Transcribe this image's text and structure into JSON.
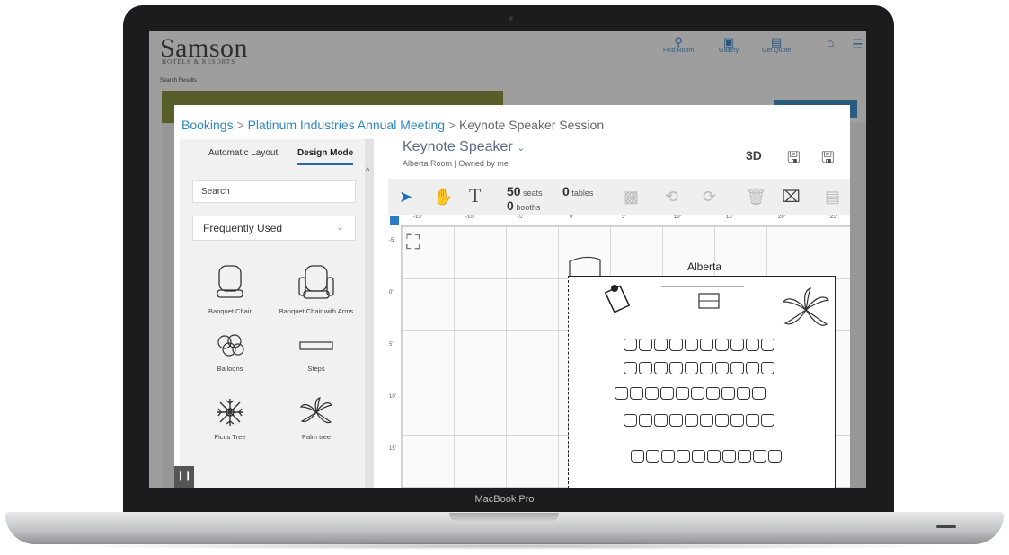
{
  "device": {
    "label": "MacBook Pro"
  },
  "site": {
    "logo": "Samson",
    "logo_sub": "HOTELS & RESORTS",
    "nav": [
      {
        "label": "Find Room",
        "icon": "search-icon"
      },
      {
        "label": "Gallery",
        "icon": "camera-icon"
      },
      {
        "label": "Get Quote",
        "icon": "document-icon"
      }
    ],
    "search_results": "Search Results"
  },
  "breadcrumb": {
    "items": [
      "Bookings",
      "Platinum Industries Annual Meeting"
    ],
    "current": "Keynote Speaker Session",
    "separator": ">"
  },
  "sidebar": {
    "tabs": [
      "Automatic Layout",
      "Design Mode"
    ],
    "active_tab": "Design Mode",
    "search_value": "Search",
    "dropdown_value": "Frequently Used",
    "items": [
      {
        "label": "Banquet Chair"
      },
      {
        "label": "Banquet Chair with Arms"
      },
      {
        "label": "Balloons"
      },
      {
        "label": "Steps"
      },
      {
        "label": "Ficus Tree"
      },
      {
        "label": "Palm tree"
      }
    ]
  },
  "design": {
    "title": "Keynote Speaker",
    "subtitle_room": "Alberta Room",
    "subtitle_owner": "Owned by me",
    "seats_count": "50",
    "seats_label": "seats",
    "tables_count": "0",
    "tables_label": "tables",
    "booths_count": "0",
    "booths_label": "booths",
    "room_label": "Alberta",
    "ruler_top": [
      "-15'",
      "-10'",
      "-5'",
      "0'",
      "5'",
      "10'",
      "15'",
      "20'",
      "25'"
    ],
    "ruler_left": [
      "-5'",
      "0'",
      "5'",
      "10'",
      "15'"
    ],
    "header_icons": [
      "3d-view-icon",
      "save-icon",
      "save-as-icon"
    ],
    "tools": [
      "select-icon",
      "pan-icon",
      "text-icon",
      "group-icon",
      "rotate-left-icon",
      "rotate-right-icon",
      "delete-icon",
      "clear-icon",
      "align-icon"
    ],
    "chair_rows": [
      10,
      10,
      10,
      10,
      10
    ]
  },
  "colors": {
    "accent": "#2e86c1",
    "green_bar": "#7f8b2c",
    "blue_bar": "#2f88c9"
  }
}
